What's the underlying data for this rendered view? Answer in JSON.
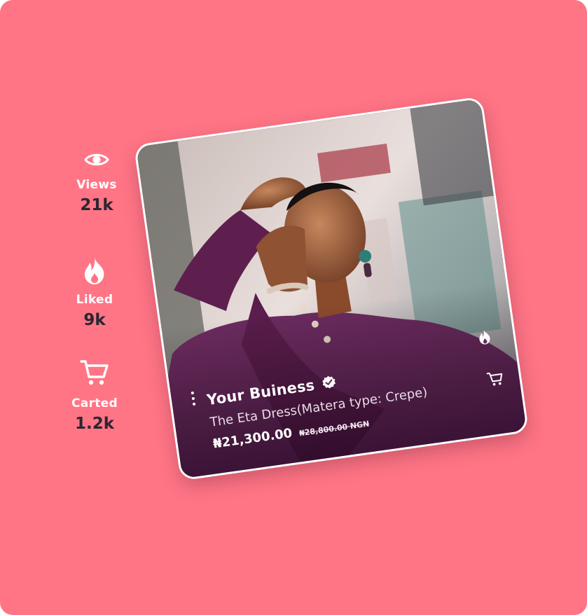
{
  "stats": {
    "views": {
      "icon": "eye-icon",
      "label": "Views",
      "value": "21k"
    },
    "liked": {
      "icon": "fire-icon",
      "label": "Liked",
      "value": "9k"
    },
    "carted": {
      "icon": "cart-icon",
      "label": "Carted",
      "value": "1.2k"
    }
  },
  "card": {
    "business_name": "Your Buiness",
    "verified_icon": "verified-badge-icon",
    "product": "The Eta Dress(Matera type: Crepe)",
    "price": "₦21,300.00",
    "old_price": "₦28,800.00 NGN",
    "menu_icon": "more-vertical-icon",
    "like_icon": "fire-icon",
    "cart_icon": "cart-icon"
  },
  "colors": {
    "background": "#ff7586",
    "stat_label": "#ffffff",
    "stat_value": "#2a2630",
    "outfit": "#6b2b5f"
  }
}
